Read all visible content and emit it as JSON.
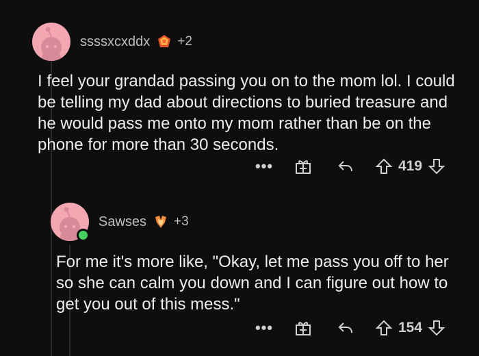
{
  "comments": [
    {
      "username": "ssssxcxddx",
      "award_count": "+2",
      "body": "I feel your grandad passing you on to the mom lol. I could be telling my dad about directions to buried treasure and he would pass me onto my mom rather than be on the phone for more than 30 seconds.",
      "score": "419",
      "more_label": "•••"
    },
    {
      "username": "Sawses",
      "award_count": "+3",
      "body": "For me it's more like, \"Okay, let me pass you off to her so she can calm you down and I can figure out how to get you out of this mess.\"",
      "score": "154",
      "more_label": "•••"
    }
  ],
  "icons": {
    "avatar": "snoo-avatar-icon",
    "award": "award-icon",
    "gift": "gift-icon",
    "reply": "reply-icon",
    "upvote": "upvote-arrow-icon",
    "downvote": "downvote-arrow-icon"
  },
  "colors": {
    "background": "#0e0e0e",
    "avatar_bg": "#f4a6b3",
    "online": "#46d160"
  }
}
